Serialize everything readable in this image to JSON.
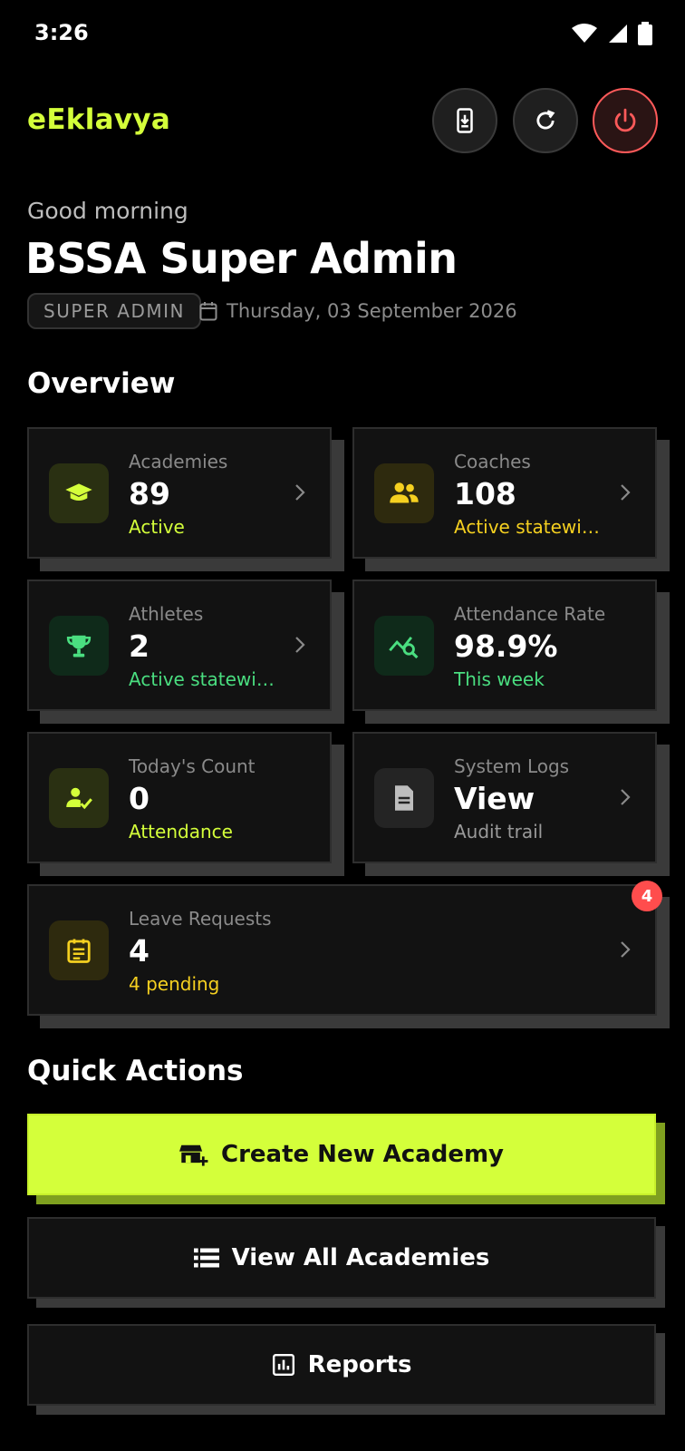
{
  "status_bar": {
    "time": "3:26"
  },
  "header": {
    "brand": "eEklavya"
  },
  "greeting": {
    "salutation": "Good morning",
    "name": "BSSA Super Admin",
    "role": "SUPER ADMIN",
    "date": "Thursday, 03 September 2026"
  },
  "overview": {
    "title": "Overview",
    "cards": [
      {
        "label": "Academies",
        "value": "89",
        "sub": "Active",
        "sub_color": "#d4ff3a",
        "icon": "graduation-cap-icon"
      },
      {
        "label": "Coaches",
        "value": "108",
        "sub": "Active statewide",
        "sub_color": "#f5d020",
        "icon": "people-icon"
      },
      {
        "label": "Athletes",
        "value": "2",
        "sub": "Active statewide",
        "sub_color": "#4ade80",
        "icon": "trophy-icon"
      },
      {
        "label": "Attendance Rate",
        "value": "98.9%",
        "sub": "This week",
        "sub_color": "#4ade80",
        "icon": "chart-search-icon"
      },
      {
        "label": "Today's Count",
        "value": "0",
        "sub": "Attendance",
        "sub_color": "#d4ff3a",
        "icon": "person-check-icon"
      },
      {
        "label": "System Logs",
        "value": "View",
        "sub": "Audit trail",
        "sub_color": "#9a9a9a",
        "icon": "document-icon"
      },
      {
        "label": "Leave Requests",
        "value": "4",
        "sub": "4 pending",
        "sub_color": "#f5d020",
        "icon": "calendar-list-icon",
        "badge": "4"
      }
    ]
  },
  "quick_actions": {
    "title": "Quick Actions",
    "create_academy": "Create New Academy",
    "view_academies": "View All Academies",
    "reports": "Reports"
  },
  "colors": {
    "accent": "#d4ff3a",
    "danger": "#ff5a5a",
    "background": "#000000"
  }
}
